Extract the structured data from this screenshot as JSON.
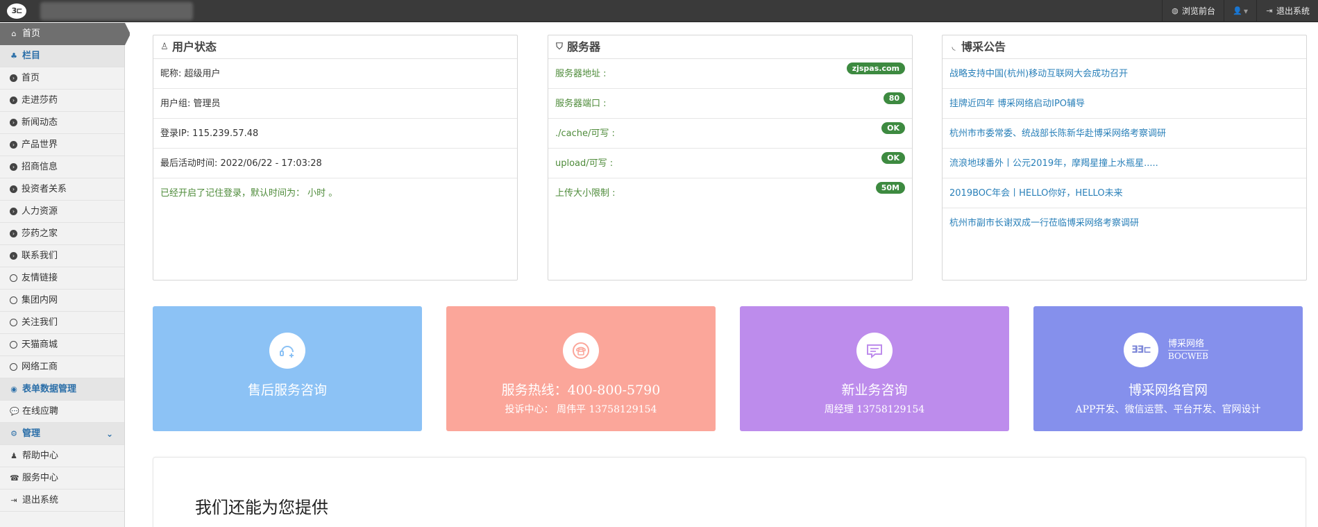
{
  "topbar": {
    "logo_text": "3⊏",
    "links": [
      {
        "icon": "globe-icon",
        "glyph": "◍",
        "label": "浏览前台"
      },
      {
        "icon": "user-icon",
        "glyph": "👤",
        "label": "▾"
      },
      {
        "icon": "logout-icon",
        "glyph": "⇥",
        "label": "退出系统"
      }
    ]
  },
  "sidebar": {
    "home": {
      "glyph": "⌂",
      "label": "首页"
    },
    "section1": {
      "glyph": "♣",
      "label": "栏目"
    },
    "items": [
      {
        "label": "首页",
        "style": "arrow"
      },
      {
        "label": "走进莎药",
        "style": "arrow"
      },
      {
        "label": "新闻动态",
        "style": "arrow"
      },
      {
        "label": "产品世界",
        "style": "arrow"
      },
      {
        "label": "招商信息",
        "style": "arrow"
      },
      {
        "label": "投资者关系",
        "style": "arrow"
      },
      {
        "label": "人力资源",
        "style": "arrow"
      },
      {
        "label": "莎药之家",
        "style": "arrow"
      },
      {
        "label": "联系我们",
        "style": "arrow"
      },
      {
        "label": "友情链接",
        "style": "empty"
      },
      {
        "label": "集团内网",
        "style": "empty"
      },
      {
        "label": "关注我们",
        "style": "empty"
      },
      {
        "label": "天猫商城",
        "style": "empty"
      },
      {
        "label": "网络工商",
        "style": "empty"
      }
    ],
    "section2": {
      "glyph": "◉",
      "label": "表单数据管理"
    },
    "form_items": [
      {
        "glyph": "💬",
        "label": "在线应聘"
      }
    ],
    "section3": {
      "glyph": "⚙",
      "label": "管理",
      "chevron": "⌄"
    },
    "admin_items": [
      {
        "glyph": "♟",
        "label": "帮助中心"
      },
      {
        "glyph": "☎",
        "label": "服务中心"
      },
      {
        "glyph": "⇥",
        "label": "退出系统"
      }
    ]
  },
  "user_panel": {
    "title": "用户状态",
    "rows": [
      "昵称:  超级用户",
      "用户组:  管理员",
      "登录IP:  115.239.57.48",
      "最后活动时间:  2022/06/22 - 17:03:28"
    ],
    "note": "已经开启了记住登录，默认时间为：  小时 。"
  },
  "server_panel": {
    "title": "服务器",
    "rows": [
      {
        "label": "服务器地址 :",
        "badge": "zjspas.com"
      },
      {
        "label": "服务器端口 :",
        "badge": "80"
      },
      {
        "label": "./cache/可写 :",
        "badge": "OK"
      },
      {
        "label": "upload/可写 :",
        "badge": "OK"
      },
      {
        "label": "上传大小限制 :",
        "badge": "50M"
      }
    ]
  },
  "news_panel": {
    "title": "博采公告",
    "items": [
      "战略支持中国(杭州)移动互联网大会成功召开",
      "挂牌近四年 博采网络启动IPO辅导",
      "杭州市市委常委、统战部长陈新华赴博采网络考察调研",
      "流浪地球番外丨公元2019年，摩羯星撞上水瓶星.....",
      "2019BOC年会丨HELLO你好，HELLO未来",
      "杭州市副市长谢双成一行莅临博采网络考察调研"
    ]
  },
  "cards": [
    {
      "title": "售后服务咨询",
      "sub": "",
      "color": "#8cc2f5"
    },
    {
      "title": "服务热线：400-800-5790",
      "sub": "投诉中心：  周伟平 13758129154",
      "color": "#fba69a"
    },
    {
      "title": "新业务咨询",
      "sub": "周经理 13758129154",
      "color": "#bd8cec"
    },
    {
      "title": "博采网络官网",
      "sub": "APP开发、微信运营、平台开发、官网设计",
      "color": "#8590ec",
      "brand_cn": "博采网络",
      "brand_en": "BOCWEB",
      "brand_logo": "ƎƎ⊏"
    }
  ],
  "bottom": {
    "heading": "我们还能为您提供"
  }
}
